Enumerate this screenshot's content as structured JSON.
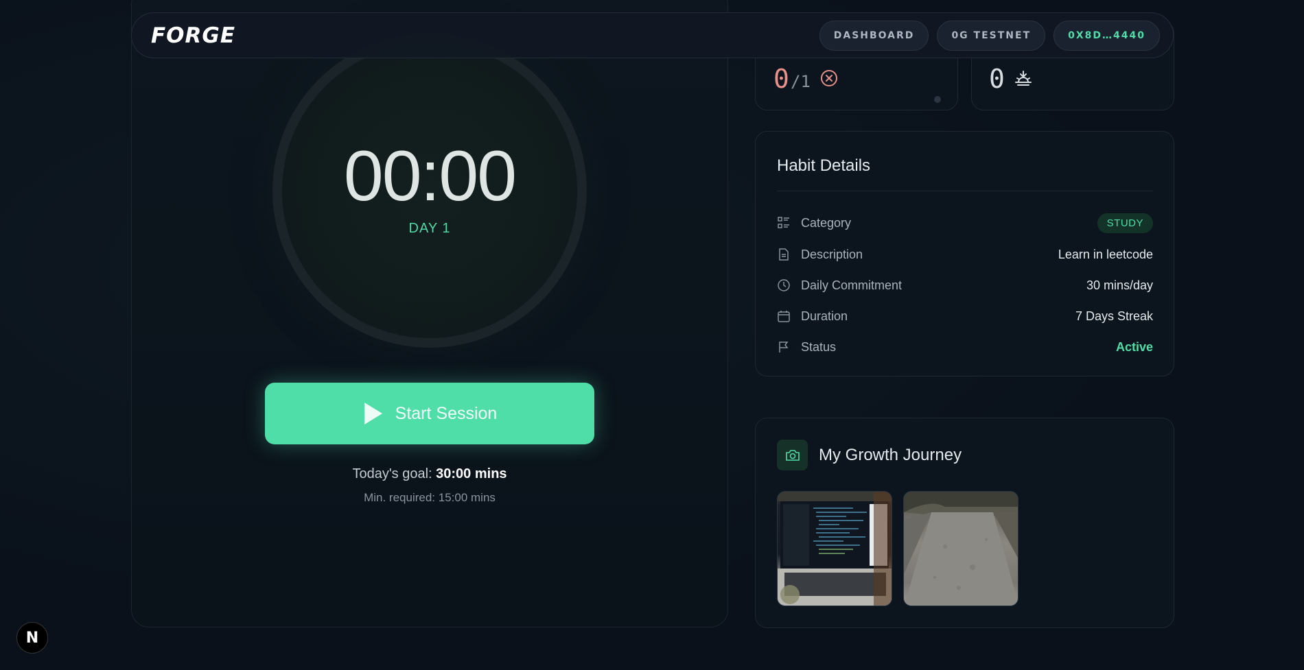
{
  "navbar": {
    "logo_text": "FORGE",
    "links": [
      "DASHBOARD",
      "0G TESTNET"
    ],
    "wallet": "0X8D…4440"
  },
  "timer": {
    "time": "00:00",
    "day": "DAY 1",
    "start_label": "Start Session",
    "goal_prefix": "Today's goal:",
    "goal_value": "30:00 mins",
    "min_required": "Min. required: 15:00 mins"
  },
  "stats": {
    "completed": "0",
    "completed_of": "/1",
    "streak": "0"
  },
  "habit": {
    "title": "Habit Details",
    "rows": [
      {
        "label": "Category",
        "value": "STUDY"
      },
      {
        "label": "Description",
        "value": "Learn in leetcode"
      },
      {
        "label": "Daily Commitment",
        "value": "30 mins/day"
      },
      {
        "label": "Duration",
        "value": "7 Days Streak"
      },
      {
        "label": "Status",
        "value": "Active"
      }
    ]
  },
  "growth": {
    "title": "My Growth Journey"
  },
  "corner_badge": "N",
  "colors": {
    "accent": "#4fdea8",
    "background": "#0a111b",
    "error": "#e8918b"
  }
}
